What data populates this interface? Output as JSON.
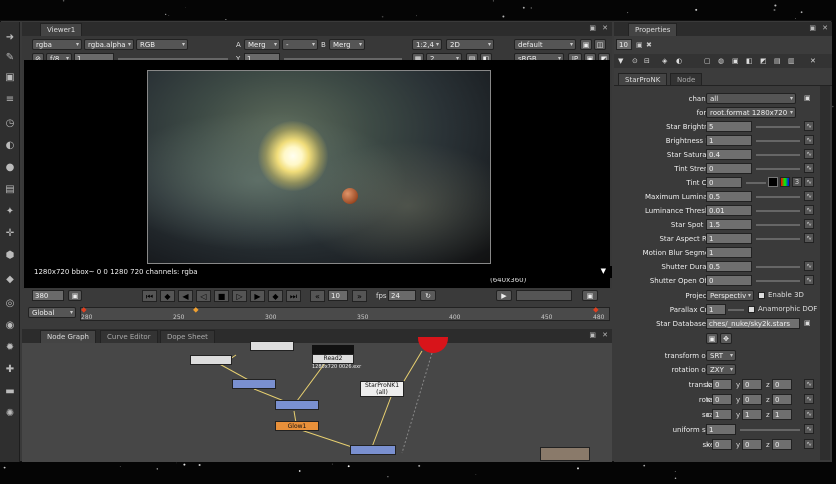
{
  "viewer": {
    "tab_title": "Viewer1",
    "channel_set": "rgba",
    "channel_alpha": "rgba.alpha",
    "channel_display": "RGB",
    "input_a_label": "A",
    "input_a_value": "Merg",
    "input_a_op": "-",
    "input_b_label": "B",
    "input_b_value": "Merg",
    "proxy": "1:2,4",
    "view_mode": "2D",
    "wipe": "default",
    "fstop": "f/8",
    "gain_value": "1",
    "y_label": "Y",
    "gamma_value": "1",
    "frame_count": "2",
    "colorspace": "sRGB",
    "ip_label": "IP",
    "resolution_label": "(640x360)",
    "info_line": "1280x720 bbox~ 0 0 1280 720 channels: rgba",
    "current_frame": "380",
    "playback_range": "Global",
    "fps_label": "fps",
    "fps_value": "24",
    "step_value": "10",
    "timeline_ticks": [
      "280",
      "250",
      "300",
      "350",
      "400",
      "450",
      "480"
    ]
  },
  "node_graph": {
    "tabs": [
      "Node Graph",
      "Curve Editor",
      "Dope Sheet"
    ],
    "nodes": [
      {
        "label": "Read2",
        "sub": "1280x720 0026.exr"
      },
      {
        "label": "StarProNK1",
        "sub": "(all)"
      },
      {
        "label": "Glow1"
      }
    ]
  },
  "properties": {
    "title": "Properties",
    "max_panels": "10",
    "tabs": [
      "StarProNK",
      "Node"
    ],
    "rows": [
      {
        "label": "channels",
        "value": "all"
      },
      {
        "label": "format",
        "value": "root.format 1280x720"
      },
      {
        "label": "Star Brightness",
        "value": "5"
      },
      {
        "label": "Brightness Bias",
        "value": "1"
      },
      {
        "label": "Star Saturation",
        "value": "0.4"
      },
      {
        "label": "Tint Strength",
        "value": "0"
      },
      {
        "label": "Tint Color",
        "value": "0"
      },
      {
        "label": "Maximum Luminance",
        "value": "0.5"
      },
      {
        "label": "Luminance Threshold",
        "value": "0.01"
      },
      {
        "label": "Star Spot Size",
        "value": "1.5"
      },
      {
        "label": "Star Aspect Ratio",
        "value": "1"
      },
      {
        "label": "Motion Blur Segments",
        "value": "1"
      },
      {
        "label": "Shutter Duration",
        "value": "0.5"
      },
      {
        "label": "Shutter Open Offset",
        "value": "0"
      },
      {
        "label": "Projection",
        "value": "Perspectiv"
      },
      {
        "label": "Parallax Crush",
        "value": "1"
      },
      {
        "label": "Star Database File",
        "value": "ches/_nuke/sky2k.stars"
      }
    ],
    "enable_3d_label": "Enable 3D",
    "anamorphic_label": "Anamorphic DOF",
    "transform_order_label": "transform order",
    "transform_order_value": "SRT",
    "rotation_order_label": "rotation order",
    "rotation_order_value": "ZXY",
    "translate_label": "translate",
    "rotate_label": "rotate",
    "scale_label": "scale",
    "uniform_scale_label": "uniform scale",
    "skew_label": "skew",
    "x_label": "x",
    "y_label": "y",
    "z_label": "z",
    "translate_x": "0",
    "translate_y": "0",
    "translate_z": "0",
    "rotate_x": "0",
    "rotate_y": "0",
    "rotate_z": "0",
    "scale_x": "1",
    "scale_y": "1",
    "scale_z": "1",
    "uniform_scale_value": "1",
    "skew_x": "0",
    "skew_y": "0",
    "skew_z": "0"
  }
}
